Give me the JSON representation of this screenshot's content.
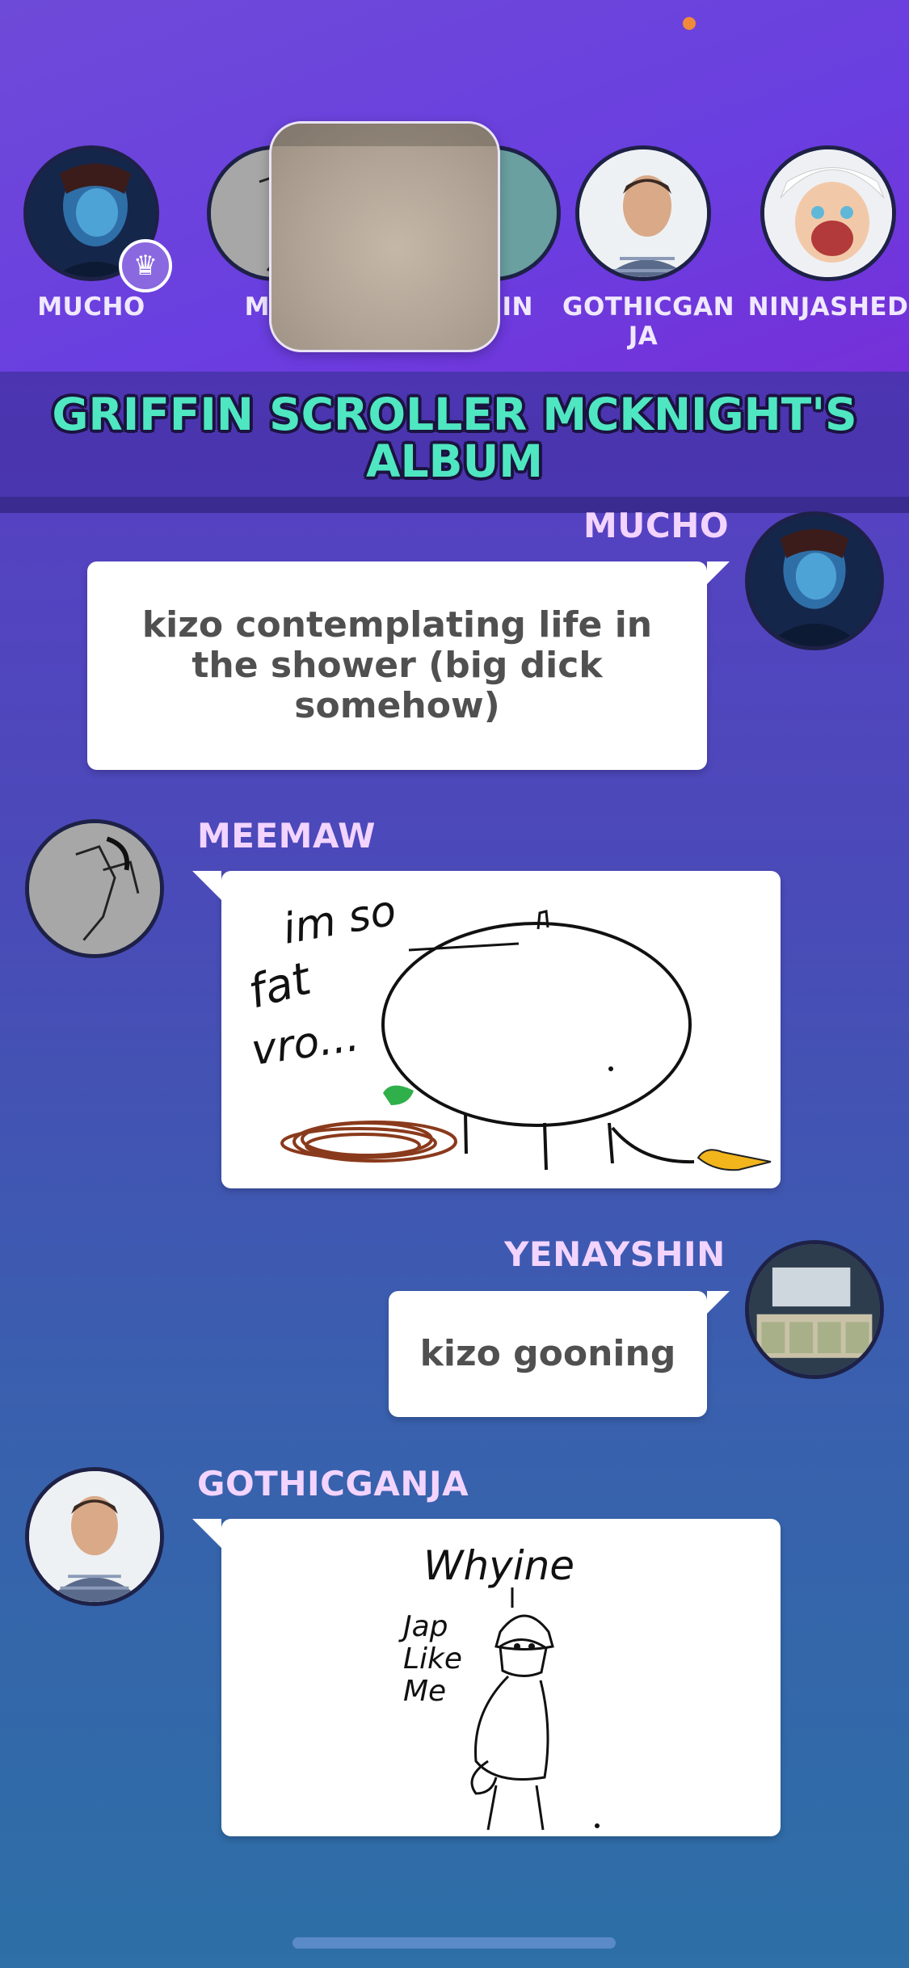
{
  "players": [
    {
      "name": "MUCHO",
      "host": true
    },
    {
      "name": "MEE"
    },
    {
      "name": "HIN"
    },
    {
      "name": "GOTHICGAN JA"
    },
    {
      "name": "NINJASHED"
    }
  ],
  "album_title": "GRIFFIN SCROLLER MCKNIGHT'S ALBUM",
  "messages": [
    {
      "author": "MUCHO",
      "text": "kizo contemplating life in the shower (big dick somehow)"
    },
    {
      "author": "MEEMAW",
      "drawing_text": [
        "im so",
        "fat",
        "vro..."
      ]
    },
    {
      "author": "YENAYSHIN",
      "text": "kizo gooning"
    },
    {
      "author": "GOTHICGANJA",
      "drawing_text": [
        "Whyine",
        "Jap",
        "Like",
        "Me"
      ]
    }
  ],
  "colors": {
    "name_accent": "#4fe7c1",
    "author_name": "#f3d4ff",
    "avatar_border": "#1e2147"
  }
}
